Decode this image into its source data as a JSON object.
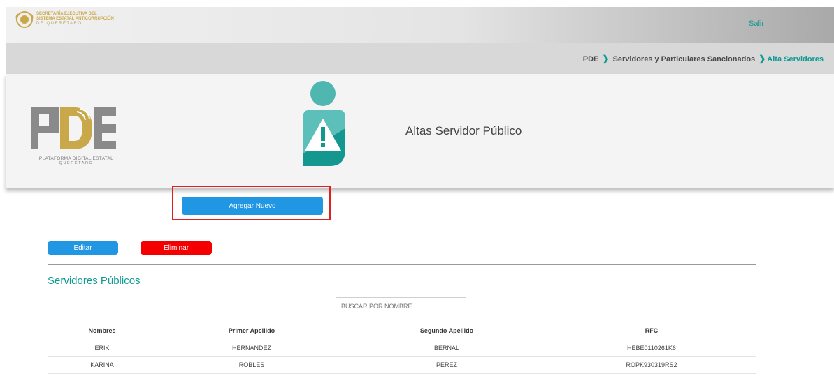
{
  "header": {
    "brand_lines": [
      "SECRETARÍA EJECUTIVA DEL",
      "SISTEMA ESTATAL ANTICORRUPCIÓN",
      "DE QUERÉTARO"
    ],
    "logout_label": "Salir"
  },
  "breadcrumb": {
    "items": [
      "PDE",
      "Servidores y Particulares Sancionados",
      "Alta Servidores"
    ],
    "separator_icon": "chevron-right-icon"
  },
  "hero": {
    "logo_caption": [
      "PLATAFORMA DIGITAL ESTATAL",
      "QUERÉTARO"
    ],
    "figure_icon": "user-warning-icon",
    "title": "Altas Servidor Público"
  },
  "actions": {
    "add_label": "Agregar Nuevo",
    "edit_label": "Editar",
    "delete_label": "Eliminar"
  },
  "section": {
    "title": "Servidores Públicos"
  },
  "search": {
    "placeholder": "BUSCAR POR NOMBRE..."
  },
  "table": {
    "columns": [
      "Nombres",
      "Primer Apellido",
      "Segundo Apellido",
      "RFC"
    ],
    "rows": [
      [
        "ERIK",
        "HERNANDEZ",
        "BERNAL",
        "HEBE0110261K6"
      ],
      [
        "KARINA",
        "ROBLES",
        "PEREZ",
        "ROPK930319RS2"
      ]
    ]
  },
  "colors": {
    "accent_teal": "#0f9a93",
    "primary_blue": "#2196e3",
    "danger_red": "#f40000",
    "highlight_red": "#e02020",
    "gold": "#c9a84a"
  }
}
